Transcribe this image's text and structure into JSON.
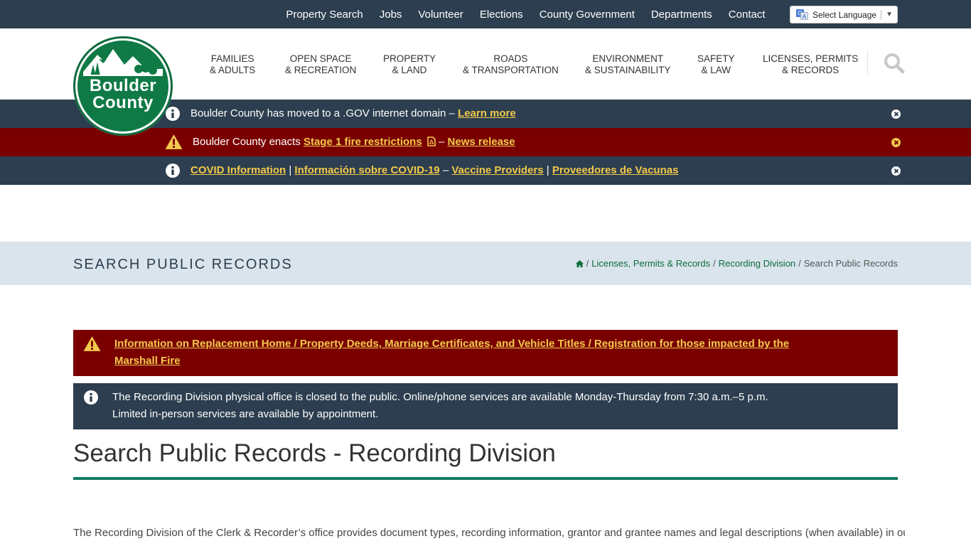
{
  "topnav": [
    "Property Search",
    "Jobs",
    "Volunteer",
    "Elections",
    "County Government",
    "Departments",
    "Contact"
  ],
  "language": {
    "label": "Select Language",
    "arrow": "▼"
  },
  "logo": {
    "line1": "Boulder",
    "line2": "County"
  },
  "mainnav": [
    {
      "line1": "FAMILIES",
      "line2": "& ADULTS"
    },
    {
      "line1": "OPEN SPACE",
      "line2": "& RECREATION"
    },
    {
      "line1": "PROPERTY",
      "line2": "& LAND"
    },
    {
      "line1": "ROADS",
      "line2": "& TRANSPORTATION"
    },
    {
      "line1": "ENVIRONMENT",
      "line2": "& SUSTAINABILITY"
    },
    {
      "line1": "SAFETY",
      "line2": "& LAW"
    },
    {
      "line1": "LICENSES, PERMITS",
      "line2": "& RECORDS"
    }
  ],
  "alerts": {
    "gov": {
      "text": "Boulder County has moved to a .GOV internet domain –",
      "link": "Learn more"
    },
    "fire": {
      "prefix": "Boulder County enacts",
      "link1": "Stage 1 fire restrictions",
      "dash": "–",
      "link2": "News release"
    },
    "covid": {
      "link1": "COVID Information",
      "sep1": "|",
      "link2": "Información sobre COVID-19",
      "dash": "–",
      "link3": "Vaccine Providers",
      "sep2": "|",
      "link4": "Proveedores de Vacunas"
    }
  },
  "titleband": {
    "title": "SEARCH PUBLIC RECORDS",
    "breadcrumb": {
      "sep": "/",
      "item1": "Licenses, Permits & Records",
      "item2": "Recording Division",
      "current": "Search Public Records"
    }
  },
  "notices": {
    "marshall": "Information on Replacement Home / Property Deeds, Marriage Certificates, and Vehicle Titles / Registration for those impacted by the Marshall Fire",
    "office": "The Recording Division physical office is closed to the public. Online/phone services are available Monday-Thursday from 7:30 a.m.–5 p.m. Limited in-person services are available by appointment."
  },
  "page": {
    "title": "Search Public Records - Recording Division",
    "intro": "The Recording Division of the Clerk & Recorder’s office provides document types, recording information, grantor and grantee names and legal descriptions (when available) in our"
  },
  "colors": {
    "navy": "#2c3e4f",
    "red": "#7a0000",
    "link_yellow": "#f2c94c",
    "green": "#0f6b3e",
    "teal_rule": "#137a5e",
    "band": "#d9e4ec"
  }
}
